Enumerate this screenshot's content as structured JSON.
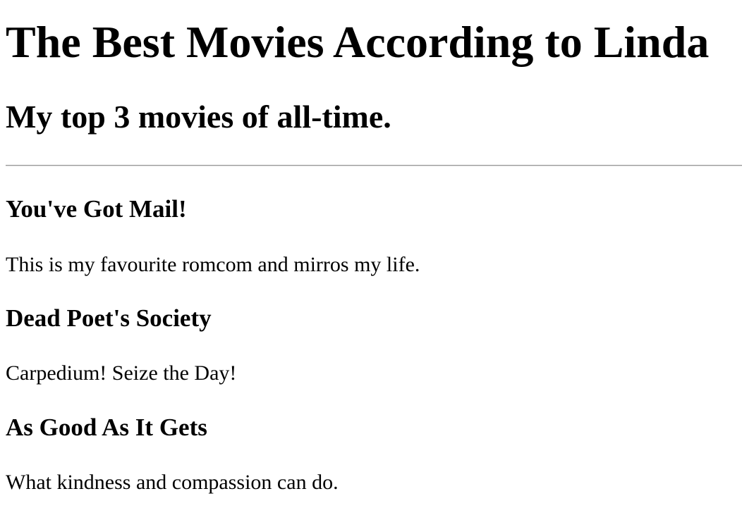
{
  "page": {
    "title": "The Best Movies According to Linda",
    "subtitle": "My top 3 movies of all-time."
  },
  "movies": [
    {
      "title": "You've Got Mail!",
      "description": "This is my favourite romcom and mirros my life."
    },
    {
      "title": "Dead Poet's Society",
      "description": "Carpedium! Seize the Day!"
    },
    {
      "title": "As Good As It Gets",
      "description": "What kindness and compassion can do."
    }
  ]
}
